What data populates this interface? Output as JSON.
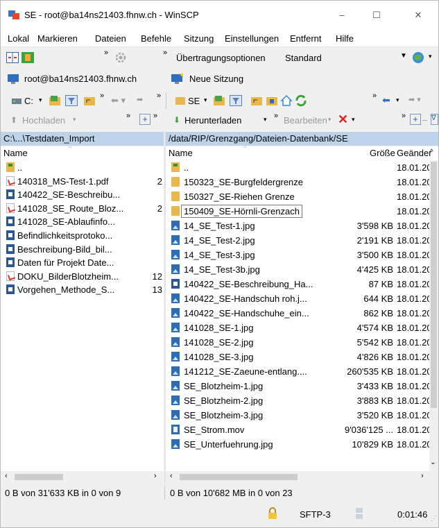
{
  "window": {
    "title": "SE - root@ba14ns21403.fhnw.ch - WinSCP",
    "minimize": "–",
    "maximize": "☐",
    "close": "✕"
  },
  "menu": [
    "Lokal",
    "Markieren",
    "Dateien",
    "Befehle",
    "Sitzung",
    "Einstellungen",
    "Entfernt",
    "Hilfe"
  ],
  "toolbar1": {
    "transfer_options_label": "Übertragungsoptionen",
    "transfer_options_value": "Standard"
  },
  "sessions": {
    "active": "root@ba14ns21403.fhnw.ch",
    "new_session": "Neue Sitzung"
  },
  "local_toolbar": {
    "drive": "C:",
    "upload": "Hochladen"
  },
  "remote_toolbar": {
    "dir": "SE",
    "download": "Herunterladen",
    "edit": "Bearbeiten"
  },
  "local": {
    "path": "C:\\...\\Testdaten_Import",
    "col_name": "Name",
    "files": [
      {
        "icon": "up",
        "name": "..",
        "size": ""
      },
      {
        "icon": "pdf",
        "name": "140318_MS-Test-1.pdf",
        "size": "2"
      },
      {
        "icon": "doc",
        "name": "140422_SE-Beschreibu...",
        "size": ""
      },
      {
        "icon": "pdf",
        "name": "141028_SE_Route_Bloz...",
        "size": "2"
      },
      {
        "icon": "doc",
        "name": "141028_SE-Ablaufinfo...",
        "size": ""
      },
      {
        "icon": "doc",
        "name": "Befindlichkeitsprotoko...",
        "size": ""
      },
      {
        "icon": "doc",
        "name": "Beschreibung-Bild_bil...",
        "size": ""
      },
      {
        "icon": "doc",
        "name": "Daten für Projekt Date...",
        "size": ""
      },
      {
        "icon": "pdf",
        "name": "DOKU_BilderBlotzheim...",
        "size": "12"
      },
      {
        "icon": "doc",
        "name": "Vorgehen_Methode_S...",
        "size": "13"
      }
    ]
  },
  "remote": {
    "path": "/data/RIP/Grenzgang/Dateien-Datenbank/SE",
    "col_name": "Name",
    "col_size": "Größe",
    "col_changed": "Geänder",
    "files": [
      {
        "icon": "up",
        "name": "..",
        "size": "",
        "date": "18.01.20"
      },
      {
        "icon": "folder",
        "name": "150323_SE-Burgfeldergrenze",
        "size": "",
        "date": "18.01.20"
      },
      {
        "icon": "folder",
        "name": "150327_SE-Riehen Grenze",
        "size": "",
        "date": "18.01.20"
      },
      {
        "icon": "folder",
        "name": "150409_SE-Hörnli-Grenzach",
        "size": "",
        "date": "18.01.20",
        "editing": true
      },
      {
        "icon": "img",
        "name": "14_SE_Test-1.jpg",
        "size": "3'598 KB",
        "date": "18.01.20"
      },
      {
        "icon": "img",
        "name": "14_SE_Test-2.jpg",
        "size": "2'191 KB",
        "date": "18.01.20"
      },
      {
        "icon": "img",
        "name": "14_SE_Test-3.jpg",
        "size": "3'500 KB",
        "date": "18.01.20"
      },
      {
        "icon": "img",
        "name": "14_SE_Test-3b.jpg",
        "size": "4'425 KB",
        "date": "18.01.20"
      },
      {
        "icon": "doc",
        "name": "140422_SE-Beschreibung_Ha...",
        "size": "87 KB",
        "date": "18.01.20"
      },
      {
        "icon": "img",
        "name": "140422_SE-Handschuh roh.j...",
        "size": "644 KB",
        "date": "18.01.20"
      },
      {
        "icon": "img",
        "name": "140422_SE-Handschuhe_ein...",
        "size": "862 KB",
        "date": "18.01.20"
      },
      {
        "icon": "img",
        "name": "141028_SE-1.jpg",
        "size": "4'574 KB",
        "date": "18.01.20"
      },
      {
        "icon": "img",
        "name": "141028_SE-2.jpg",
        "size": "5'542 KB",
        "date": "18.01.20"
      },
      {
        "icon": "img",
        "name": "141028_SE-3.jpg",
        "size": "4'826 KB",
        "date": "18.01.20"
      },
      {
        "icon": "img",
        "name": "141212_SE-Zaeune-entlang....",
        "size": "260'535 KB",
        "date": "18.01.20"
      },
      {
        "icon": "img",
        "name": "SE_Blotzheim-1.jpg",
        "size": "3'433 KB",
        "date": "18.01.20"
      },
      {
        "icon": "img",
        "name": "SE_Blotzheim-2.jpg",
        "size": "3'883 KB",
        "date": "18.01.20"
      },
      {
        "icon": "img",
        "name": "SE_Blotzheim-3.jpg",
        "size": "3'520 KB",
        "date": "18.01.20"
      },
      {
        "icon": "mov",
        "name": "SE_Strom.mov",
        "size": "9'036'125 ...",
        "date": "18.01.20"
      },
      {
        "icon": "img",
        "name": "SE_Unterfuehrung.jpg",
        "size": "10'829 KB",
        "date": "18.01.20"
      }
    ]
  },
  "status": {
    "local": "0 B von 31'633 KB in 0 von 9",
    "remote": "0 B von 10'682 MB in 0 von 23",
    "protocol": "SFTP-3",
    "time": "0:01:46"
  }
}
